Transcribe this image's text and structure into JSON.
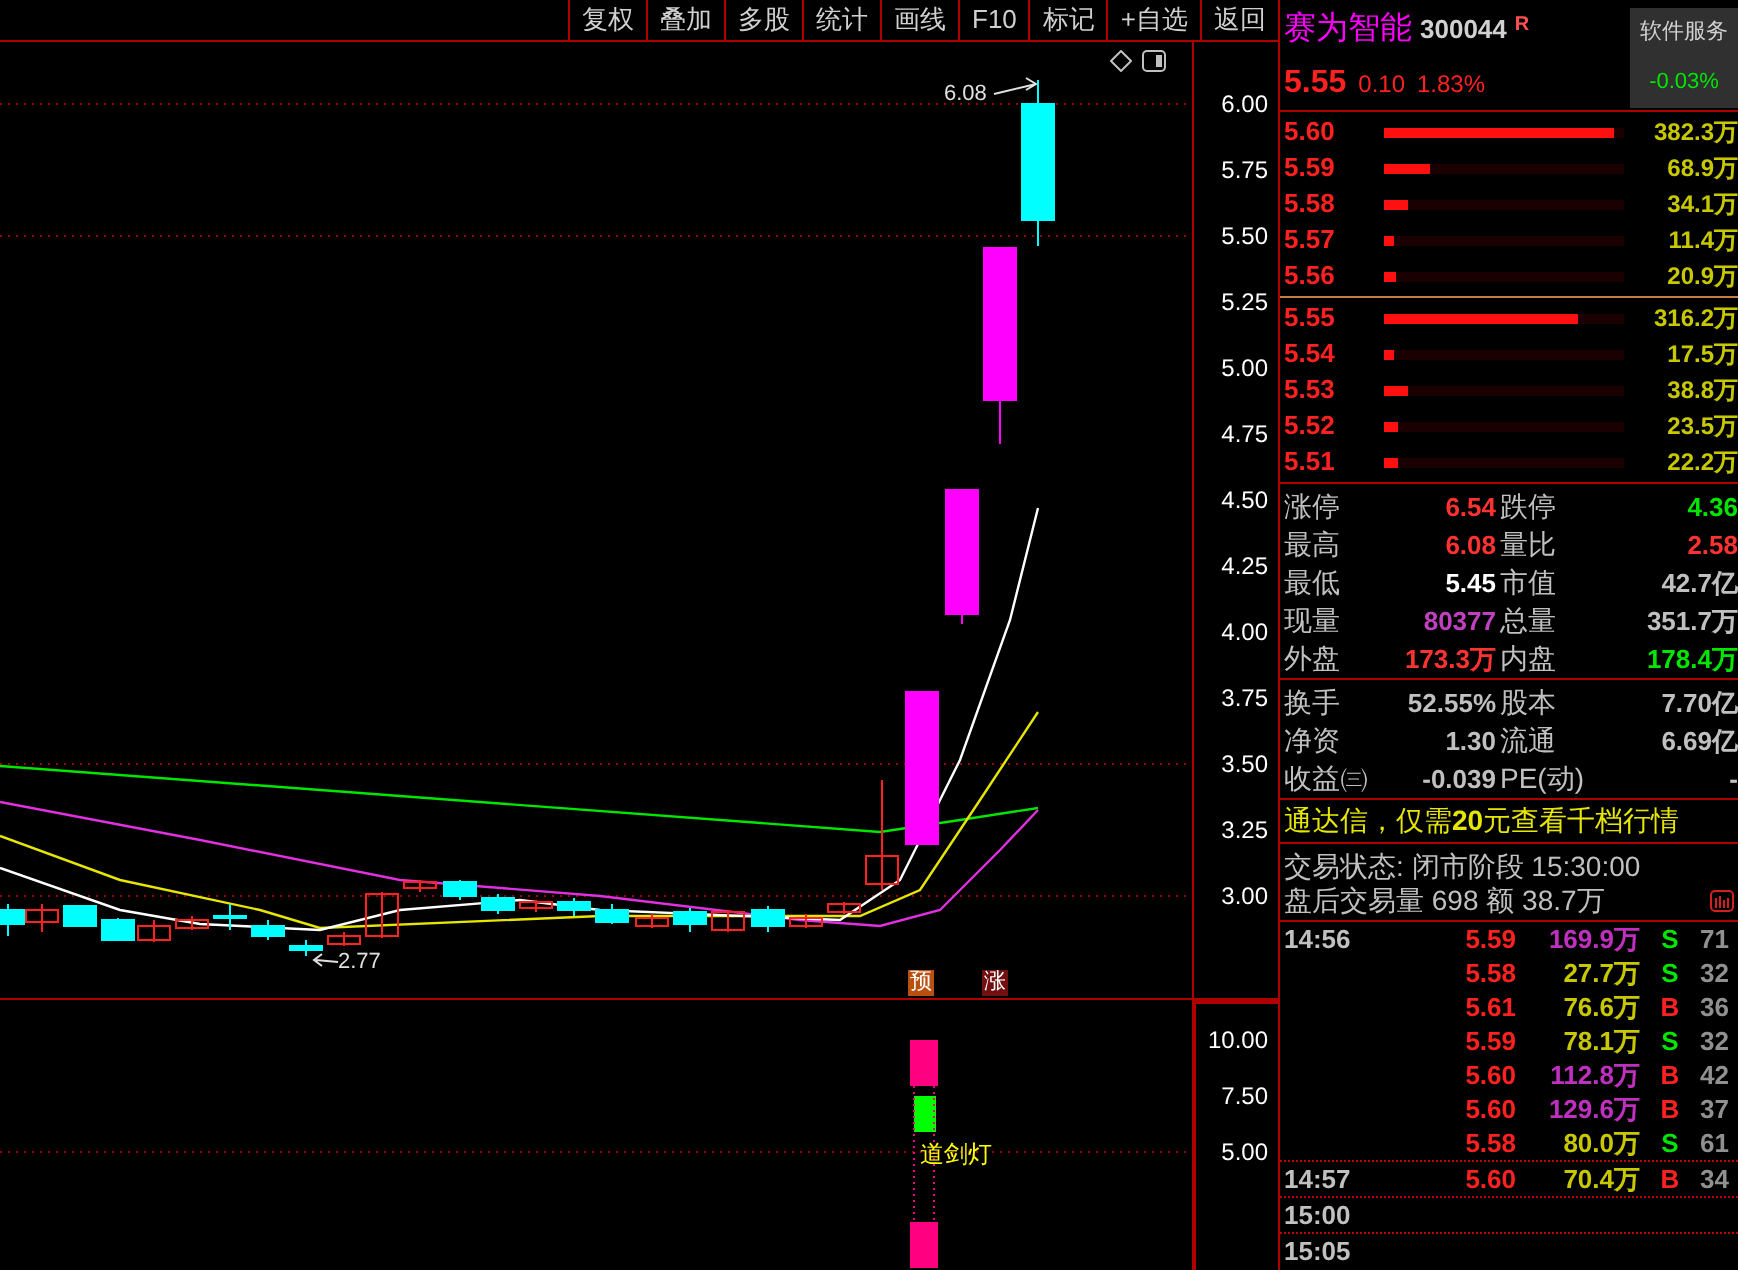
{
  "toolbar": [
    "复权",
    "叠加",
    "多股",
    "统计",
    "画线",
    "F10",
    "标记",
    "+自选",
    "返回"
  ],
  "chart": {
    "high_label": "6.08",
    "low_label": "2.77",
    "signals": [
      "预",
      "涨"
    ],
    "price_axis": [
      "6.00",
      "5.75",
      "5.50",
      "5.25",
      "5.00",
      "4.75",
      "4.50",
      "4.25",
      "4.00",
      "3.75",
      "3.50",
      "3.25",
      "3.00"
    ]
  },
  "indicator": {
    "label": "道剑灯",
    "axis": [
      "10.00",
      "7.50",
      "5.00"
    ]
  },
  "quote": {
    "name": "赛为智能",
    "code": "300044",
    "badge": "R",
    "price": "5.55",
    "change": "0.10",
    "change_pct": "1.83%",
    "service": {
      "title": "软件服务",
      "change": "-0.03%"
    }
  },
  "asks": [
    {
      "price": "5.60",
      "level": 0.96,
      "volume": "382.3万"
    },
    {
      "price": "5.59",
      "level": 0.19,
      "volume": "68.9万"
    },
    {
      "price": "5.58",
      "level": 0.1,
      "volume": "34.1万"
    },
    {
      "price": "5.57",
      "level": 0.04,
      "volume": "11.4万"
    },
    {
      "price": "5.56",
      "level": 0.05,
      "volume": "20.9万"
    }
  ],
  "bids": [
    {
      "price": "5.55",
      "level": 0.81,
      "volume": "316.2万"
    },
    {
      "price": "5.54",
      "level": 0.04,
      "volume": "17.5万"
    },
    {
      "price": "5.53",
      "level": 0.1,
      "volume": "38.8万"
    },
    {
      "price": "5.52",
      "level": 0.06,
      "volume": "23.5万"
    },
    {
      "price": "5.51",
      "level": 0.06,
      "volume": "22.2万"
    }
  ],
  "stats": [
    {
      "cells": [
        {
          "label": "涨停",
          "value": "6.54",
          "color": "#ff3232"
        },
        {
          "label": "跌停",
          "value": "4.36",
          "color": "#00e600"
        }
      ]
    },
    {
      "cells": [
        {
          "label": "最高",
          "value": "6.08",
          "color": "#ff3232"
        },
        {
          "label": "量比",
          "value": "2.58",
          "color": "#ff3232"
        }
      ]
    },
    {
      "cells": [
        {
          "label": "最低",
          "value": "5.45",
          "color": "#ffffff"
        },
        {
          "label": "市值",
          "value": "42.7亿",
          "color": "#c0c0c0"
        }
      ]
    },
    {
      "cells": [
        {
          "label": "现量",
          "value": "80377",
          "color": "#c040c0"
        },
        {
          "label": "总量",
          "value": "351.7万",
          "color": "#c0c0c0"
        }
      ]
    },
    {
      "cells": [
        {
          "label": "外盘",
          "value": "173.3万",
          "color": "#ff3232"
        },
        {
          "label": "内盘",
          "value": "178.4万",
          "color": "#00e600"
        }
      ]
    }
  ],
  "fundamentals": [
    {
      "label": "换手",
      "value": "52.55%",
      "label2": "股本",
      "value2": "7.70亿"
    },
    {
      "label": "净资",
      "value": "1.30",
      "label2": "流通",
      "value2": "6.69亿"
    },
    {
      "label": "收益㈢",
      "value": "-0.039",
      "label2": "PE(动)",
      "value2": "-"
    }
  ],
  "promo": "通达信，仅需**20**元查看千档行情",
  "status": {
    "state": "交易状态: 闭市阶段 15:30:00",
    "after_hours": "盘后交易量 698 额 38.7万"
  },
  "tick_groups": [
    {
      "time": "14:56",
      "trades": [
        {
          "price": "5.59",
          "amount": "169.9万",
          "color": "#c030c0",
          "side": "S",
          "kind": "sell",
          "count": "71"
        },
        {
          "price": "5.58",
          "amount": "27.7万",
          "color": "#c8c800",
          "side": "S",
          "kind": "sell",
          "count": "32"
        },
        {
          "price": "5.61",
          "amount": "76.6万",
          "color": "#c8c800",
          "side": "B",
          "kind": "buy",
          "count": "36"
        },
        {
          "price": "5.59",
          "amount": "78.1万",
          "color": "#c8c800",
          "side": "S",
          "kind": "sell",
          "count": "32"
        },
        {
          "price": "5.60",
          "amount": "112.8万",
          "color": "#c030c0",
          "side": "B",
          "kind": "buy",
          "count": "42"
        },
        {
          "price": "5.60",
          "amount": "129.6万",
          "color": "#c030c0",
          "side": "B",
          "kind": "buy",
          "count": "37"
        },
        {
          "price": "5.58",
          "amount": "80.0万",
          "color": "#c8c800",
          "side": "S",
          "kind": "sell",
          "count": "61"
        }
      ]
    },
    {
      "time": "14:57",
      "trades": [
        {
          "price": "5.60",
          "amount": "70.4万",
          "color": "#c8c800",
          "side": "B",
          "kind": "buy",
          "count": "34"
        }
      ]
    },
    {
      "time": "15:00"
    },
    {
      "time": "15:05"
    }
  ]
}
